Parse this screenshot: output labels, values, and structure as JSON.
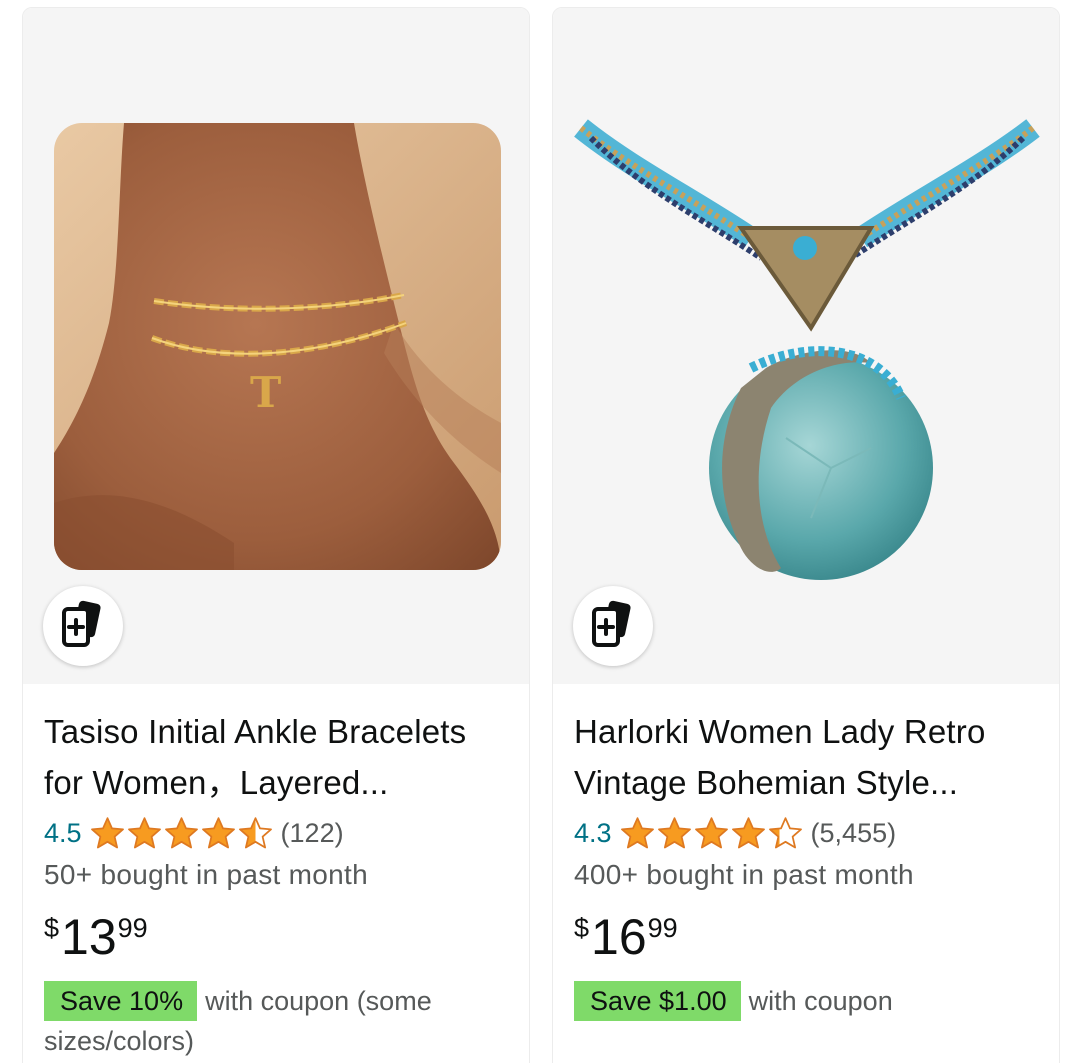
{
  "products": [
    {
      "title": "Tasiso Initial Ankle Bracelets for Women，Layered...",
      "rating": "4.5",
      "rating_value": 4.5,
      "review_count": "(122)",
      "bought": "50+ bought in past month",
      "price_symbol": "$",
      "price_whole": "13",
      "price_fraction": "99",
      "coupon_badge": "Save 10%",
      "coupon_text": "with coupon (some sizes/colors)",
      "pendant_letter": "T",
      "compare_icon": "compare-cards-icon"
    },
    {
      "title": "Harlorki Women Lady Retro Vintage Bohemian Style...",
      "rating": "4.3",
      "rating_value": 4.3,
      "review_count": "(5,455)",
      "bought": "400+ bought in past month",
      "price_symbol": "$",
      "price_whole": "16",
      "price_fraction": "99",
      "coupon_badge": "Save $1.00",
      "coupon_text": "with coupon",
      "compare_icon": "compare-cards-icon"
    }
  ],
  "colors": {
    "star": "#f79b20",
    "rating_link": "#007185",
    "coupon_badge": "#7fda69",
    "text_secondary": "#565959"
  }
}
